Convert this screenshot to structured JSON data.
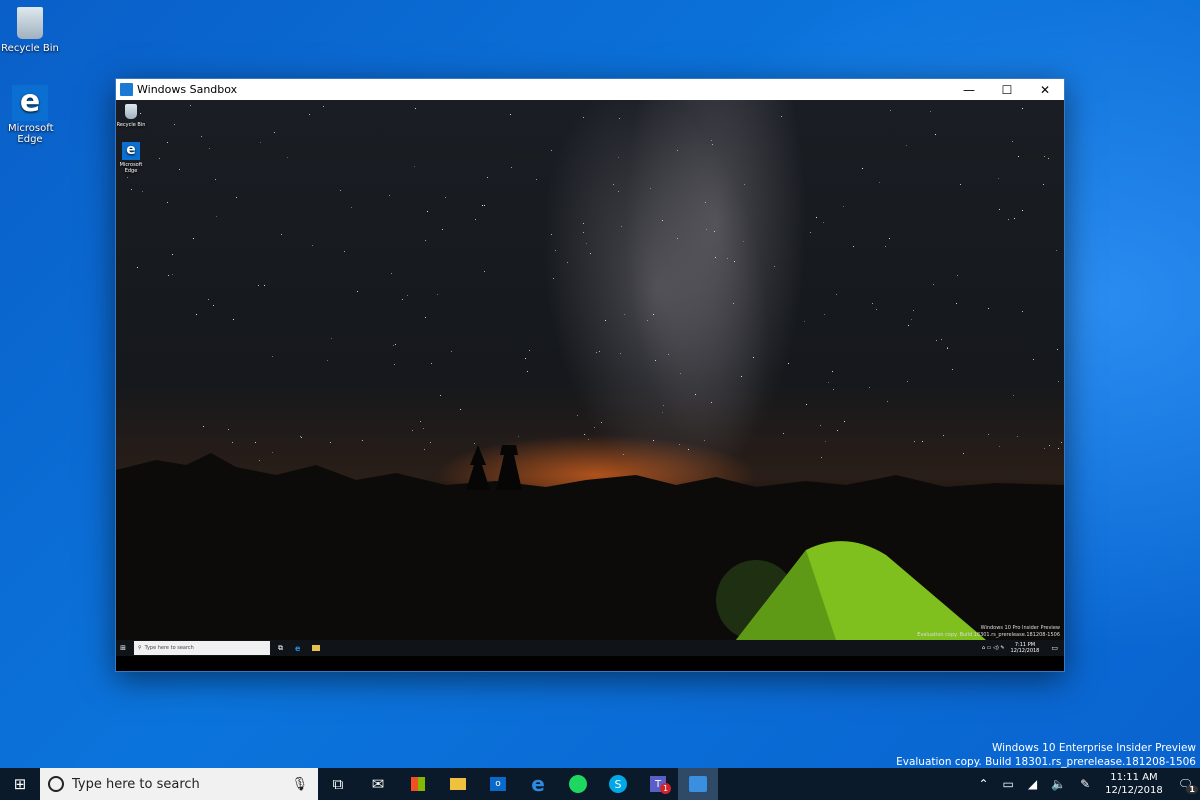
{
  "desktop": {
    "icons": [
      {
        "label": "Recycle Bin",
        "icon": "recycle-bin-icon"
      },
      {
        "label": "Microsoft Edge",
        "icon": "edge-icon"
      }
    ]
  },
  "sandbox": {
    "title": "Windows Sandbox",
    "controls": {
      "minimize": "—",
      "maximize": "☐",
      "close": "✕"
    },
    "desktop_icons": [
      {
        "label": "Recycle Bin"
      },
      {
        "label": "Microsoft Edge"
      }
    ],
    "watermark": {
      "line1": "Windows 10 Pro Insider Preview",
      "line2": "Evaluation copy. Build 18301.rs_prerelease.181208-1506"
    },
    "taskbar": {
      "search_placeholder": "Type here to search",
      "time": "7:11 PM",
      "date": "12/12/2018"
    }
  },
  "watermark": {
    "line1": "Windows 10 Enterprise Insider Preview",
    "line2": "Evaluation copy. Build 18301.rs_prerelease.181208-1506"
  },
  "taskbar": {
    "search_placeholder": "Type here to search",
    "apps": [
      "task-view",
      "mail",
      "store",
      "file-explorer",
      "outlook",
      "edge",
      "spotify",
      "skype",
      "teams",
      "windows-sandbox"
    ],
    "teams_badge": "1",
    "time": "11:11 AM",
    "date": "12/12/2018",
    "notification_count": "1",
    "accent": "#0b1a2a"
  }
}
